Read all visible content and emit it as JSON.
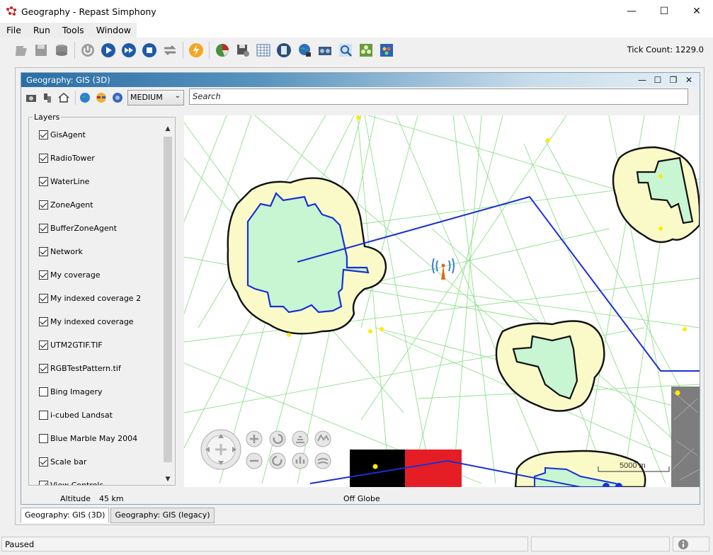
{
  "window": {
    "title": "Geography - Repast Simphony"
  },
  "menu": [
    "File",
    "Run",
    "Tools",
    "Window"
  ],
  "tick_count": "Tick Count: 1229.0",
  "internal_frame": {
    "title": "Geography: GIS (3D)",
    "detail_combo": "MEDIUM",
    "search_placeholder": "Search"
  },
  "layers": {
    "title": "Layers",
    "items": [
      {
        "label": "GisAgent",
        "checked": true
      },
      {
        "label": "RadioTower",
        "checked": true
      },
      {
        "label": "WaterLine",
        "checked": true
      },
      {
        "label": "ZoneAgent",
        "checked": true
      },
      {
        "label": "BufferZoneAgent",
        "checked": true
      },
      {
        "label": "Network",
        "checked": true
      },
      {
        "label": "My coverage",
        "checked": true
      },
      {
        "label": "My indexed coverage 2",
        "checked": true
      },
      {
        "label": "My indexed coverage",
        "checked": true
      },
      {
        "label": "UTM2GTIF.TIF",
        "checked": true
      },
      {
        "label": "RGBTestPattern.tif",
        "checked": true
      },
      {
        "label": "Bing Imagery",
        "checked": false
      },
      {
        "label": "i-cubed Landsat",
        "checked": false
      },
      {
        "label": "Blue Marble May 2004",
        "checked": false
      },
      {
        "label": "Scale bar",
        "checked": true
      },
      {
        "label": "View Controls",
        "checked": true
      }
    ]
  },
  "map": {
    "scale_label": "5000 m"
  },
  "status_line": {
    "altitude_label": "Altitude",
    "altitude_value": "45 km",
    "globe_status": "Off Globe"
  },
  "tabs": [
    "Geography: GIS (3D)",
    "Geography: GIS (legacy)"
  ],
  "statusbar": {
    "text": "Paused"
  }
}
